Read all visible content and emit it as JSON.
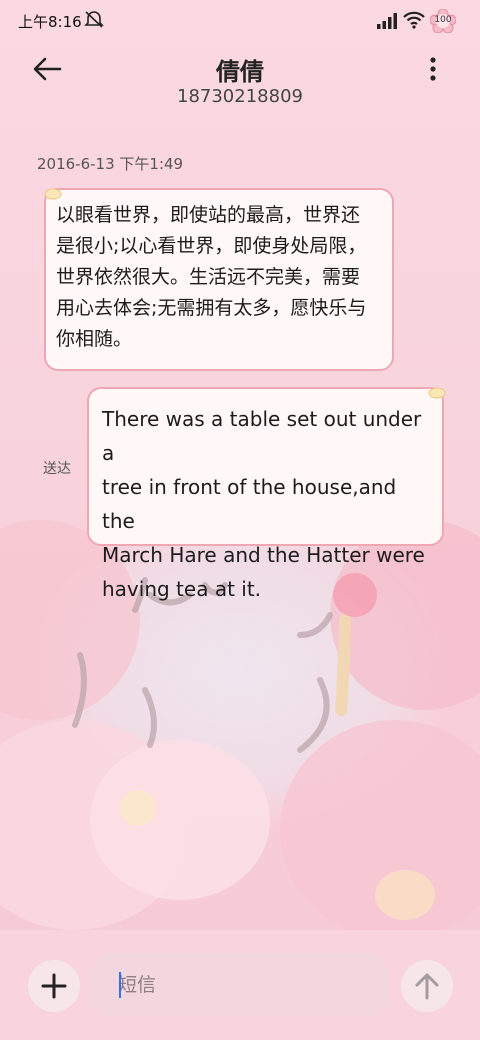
{
  "status_bar": {
    "time": "上午8:16",
    "battery_level": "100",
    "icons": [
      "mute-icon",
      "signal-icon",
      "wifi-icon",
      "battery-flower-icon"
    ]
  },
  "header": {
    "contact_name": "倩倩",
    "phone_number": "18730218809",
    "back_icon": "arrow-left-icon",
    "menu_icon": "more-vertical-icon"
  },
  "conversation": {
    "timestamp": "2016-6-13 下午1:49",
    "messages": [
      {
        "direction": "incoming",
        "lines": [
          "以眼看世界，即使站的最高，世界还",
          "是很小;以心看世界，即使身处局限，",
          "世界依然很大。生活远不完美，需要",
          "用心去体会;无需拥有太多，愿快乐与",
          "你相随。"
        ]
      },
      {
        "direction": "outgoing",
        "status": "送达",
        "lines": [
          "There was a table set out under a",
          "tree in front of the house,and the",
          "March Hare and the Hatter were",
          "having tea at it."
        ]
      }
    ]
  },
  "composer": {
    "placeholder": "短信",
    "add_icon": "plus-icon",
    "send_icon": "arrow-up-icon"
  },
  "colors": {
    "background": "#f8d3dc",
    "bubble_fill": "#fff8f7",
    "bubble_border": "#f0a7b4",
    "caret": "#3570e8"
  }
}
